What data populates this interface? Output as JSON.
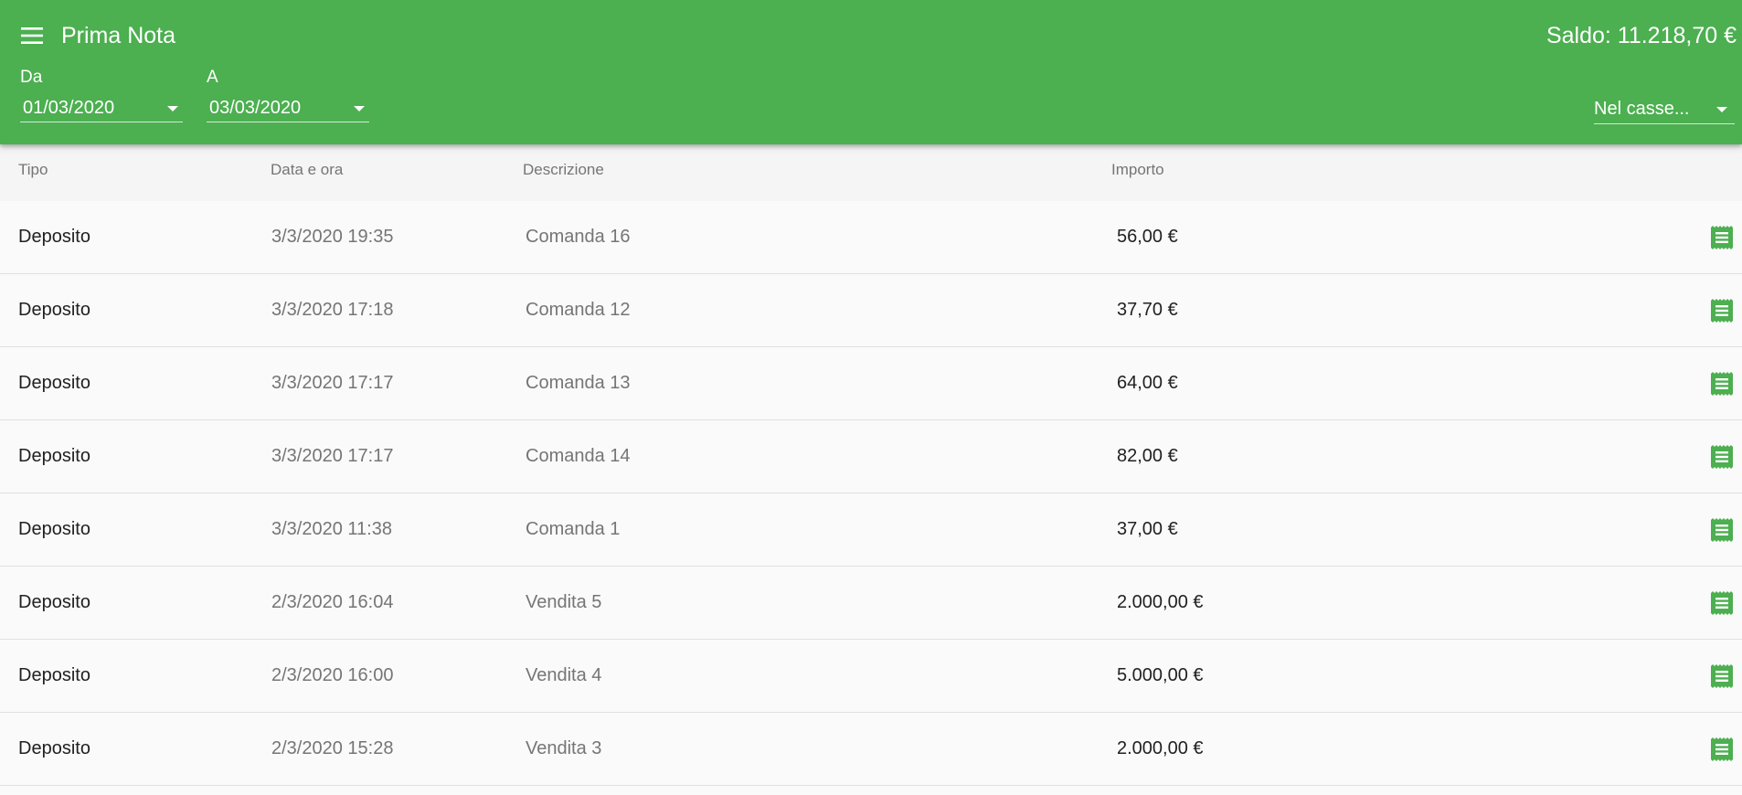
{
  "header": {
    "title": "Prima Nota",
    "balance": "Saldo: 11.218,70 €",
    "menu_icon": "menu-icon",
    "accent_color": "#4caf50"
  },
  "filters": {
    "from_label": "Da",
    "from_value": "01/03/2020",
    "to_label": "A",
    "to_value": "03/03/2020",
    "cash_value": "Nel casse..."
  },
  "table": {
    "columns": [
      "Tipo",
      "Data e ora",
      "Descrizione",
      "Importo"
    ],
    "rows": [
      {
        "tipo": "Deposito",
        "data": "3/3/2020 19:35",
        "descrizione": "Comanda 16",
        "importo": "56,00 €"
      },
      {
        "tipo": "Deposito",
        "data": "3/3/2020 17:18",
        "descrizione": "Comanda 12",
        "importo": "37,70 €"
      },
      {
        "tipo": "Deposito",
        "data": "3/3/2020 17:17",
        "descrizione": "Comanda 13",
        "importo": "64,00 €"
      },
      {
        "tipo": "Deposito",
        "data": "3/3/2020 17:17",
        "descrizione": "Comanda 14",
        "importo": "82,00 €"
      },
      {
        "tipo": "Deposito",
        "data": "3/3/2020 11:38",
        "descrizione": "Comanda 1",
        "importo": "37,00 €"
      },
      {
        "tipo": "Deposito",
        "data": "2/3/2020 16:04",
        "descrizione": "Vendita 5",
        "importo": "2.000,00 €"
      },
      {
        "tipo": "Deposito",
        "data": "2/3/2020 16:00",
        "descrizione": "Vendita 4",
        "importo": "5.000,00 €"
      },
      {
        "tipo": "Deposito",
        "data": "2/3/2020 15:28",
        "descrizione": "Vendita 3",
        "importo": "2.000,00 €"
      }
    ],
    "row_icon": "receipt-icon"
  }
}
